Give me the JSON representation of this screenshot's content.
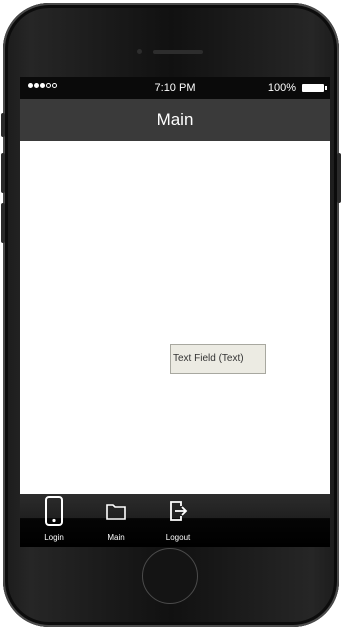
{
  "status_bar": {
    "time": "7:10 PM",
    "battery_percent": "100%",
    "signal_dots_filled": 3,
    "signal_dots_total": 5
  },
  "nav_bar": {
    "title": "Main"
  },
  "content": {
    "text_field_value": "Text Field (Text)"
  },
  "tab_bar": {
    "items": [
      {
        "label": "Login",
        "icon": "phone-icon"
      },
      {
        "label": "Main",
        "icon": "folder-icon"
      },
      {
        "label": "Logout",
        "icon": "logout-icon"
      }
    ]
  },
  "colors": {
    "nav_bar_background": "#3a3a3a",
    "status_bar_background": "#0a0a0a",
    "tab_bar_background": "#000000",
    "text_field_background": "#ecebe3"
  }
}
